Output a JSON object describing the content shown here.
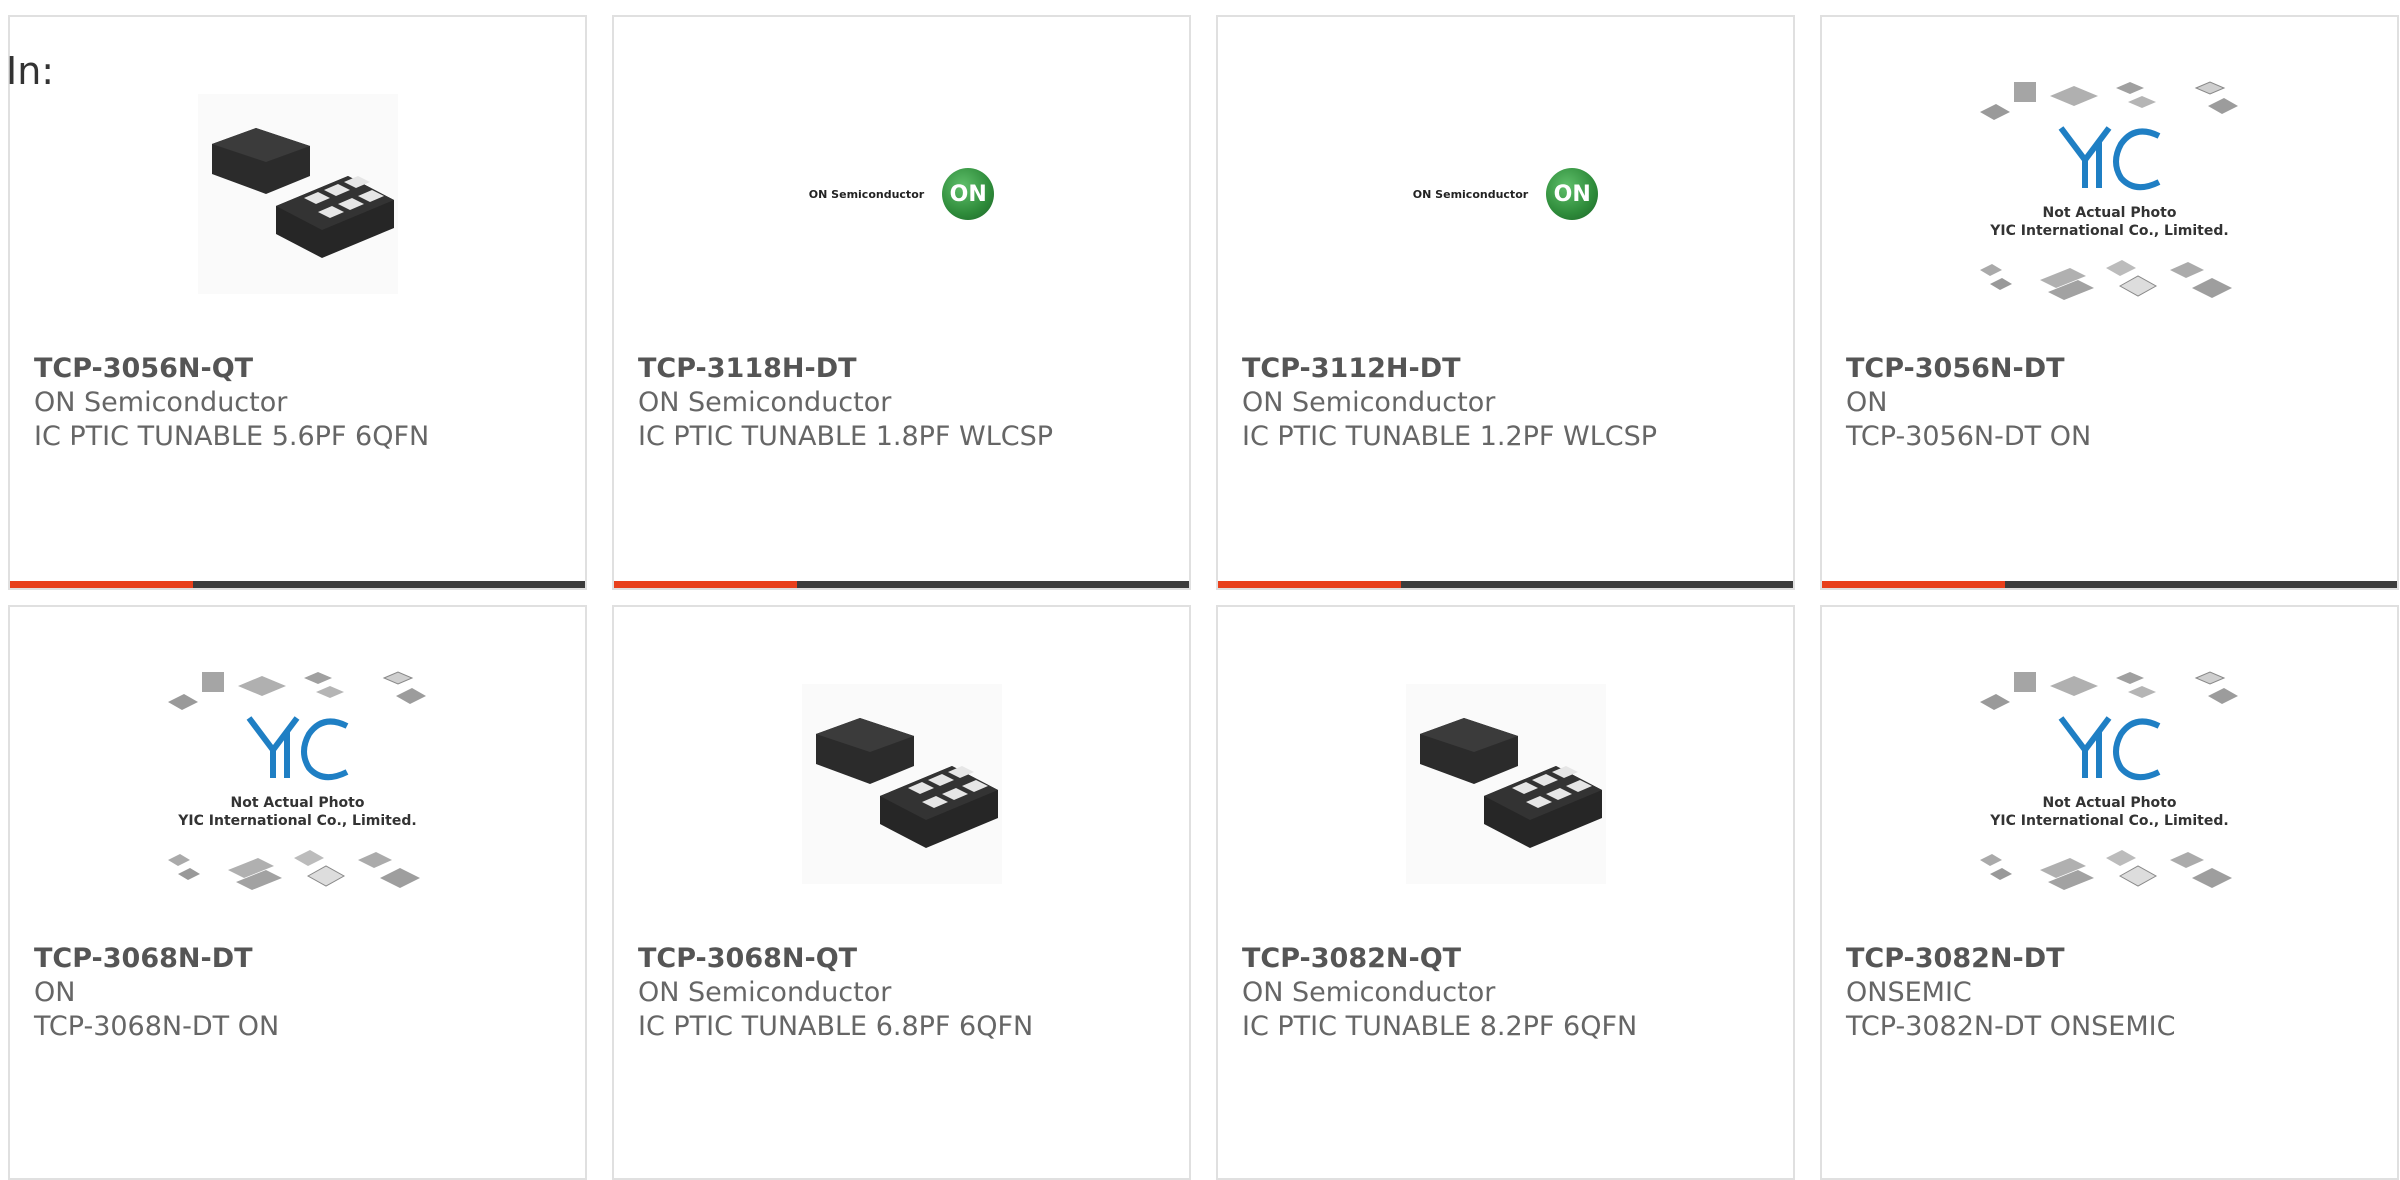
{
  "filter": {
    "label": "In:"
  },
  "colors": {
    "accent": "#e8401c",
    "bar": "#3c3c3c",
    "on_green": "#2e8b3a",
    "yic_blue": "#1f7fc4"
  },
  "products": [
    {
      "part_number": "TCP-3056N-QT",
      "manufacturer": "ON Semiconductor",
      "description": "IC PTIC TUNABLE 5.6PF 6QFN",
      "image": "qfn-package-photo"
    },
    {
      "part_number": "TCP-3118H-DT",
      "manufacturer": "ON Semiconductor",
      "description": "IC PTIC TUNABLE 1.8PF WLCSP",
      "image": "on-semiconductor-logo",
      "logo_text": "ON Semiconductor",
      "logo_badge": "ON"
    },
    {
      "part_number": "TCP-3112H-DT",
      "manufacturer": "ON Semiconductor",
      "description": "IC PTIC TUNABLE 1.2PF WLCSP",
      "image": "on-semiconductor-logo",
      "logo_text": "ON Semiconductor",
      "logo_badge": "ON"
    },
    {
      "part_number": "TCP-3056N-DT",
      "manufacturer": "ON",
      "description": "TCP-3056N-DT ON",
      "image": "not-actual-photo-placeholder",
      "placeholder_line1": "Not Actual Photo",
      "placeholder_line2": "YIC International Co., Limited."
    },
    {
      "part_number": "TCP-3068N-DT",
      "manufacturer": "ON",
      "description": "TCP-3068N-DT ON",
      "image": "not-actual-photo-placeholder",
      "placeholder_line1": "Not Actual Photo",
      "placeholder_line2": "YIC International Co., Limited."
    },
    {
      "part_number": "TCP-3068N-QT",
      "manufacturer": "ON Semiconductor",
      "description": "IC PTIC TUNABLE 6.8PF 6QFN",
      "image": "qfn-package-photo"
    },
    {
      "part_number": "TCP-3082N-QT",
      "manufacturer": "ON Semiconductor",
      "description": "IC PTIC TUNABLE 8.2PF 6QFN",
      "image": "qfn-package-photo"
    },
    {
      "part_number": "TCP-3082N-DT",
      "manufacturer": "ONSEMIC",
      "description": "TCP-3082N-DT ONSEMIC",
      "image": "not-actual-photo-placeholder",
      "placeholder_line1": "Not Actual Photo",
      "placeholder_line2": "YIC International Co., Limited."
    }
  ]
}
